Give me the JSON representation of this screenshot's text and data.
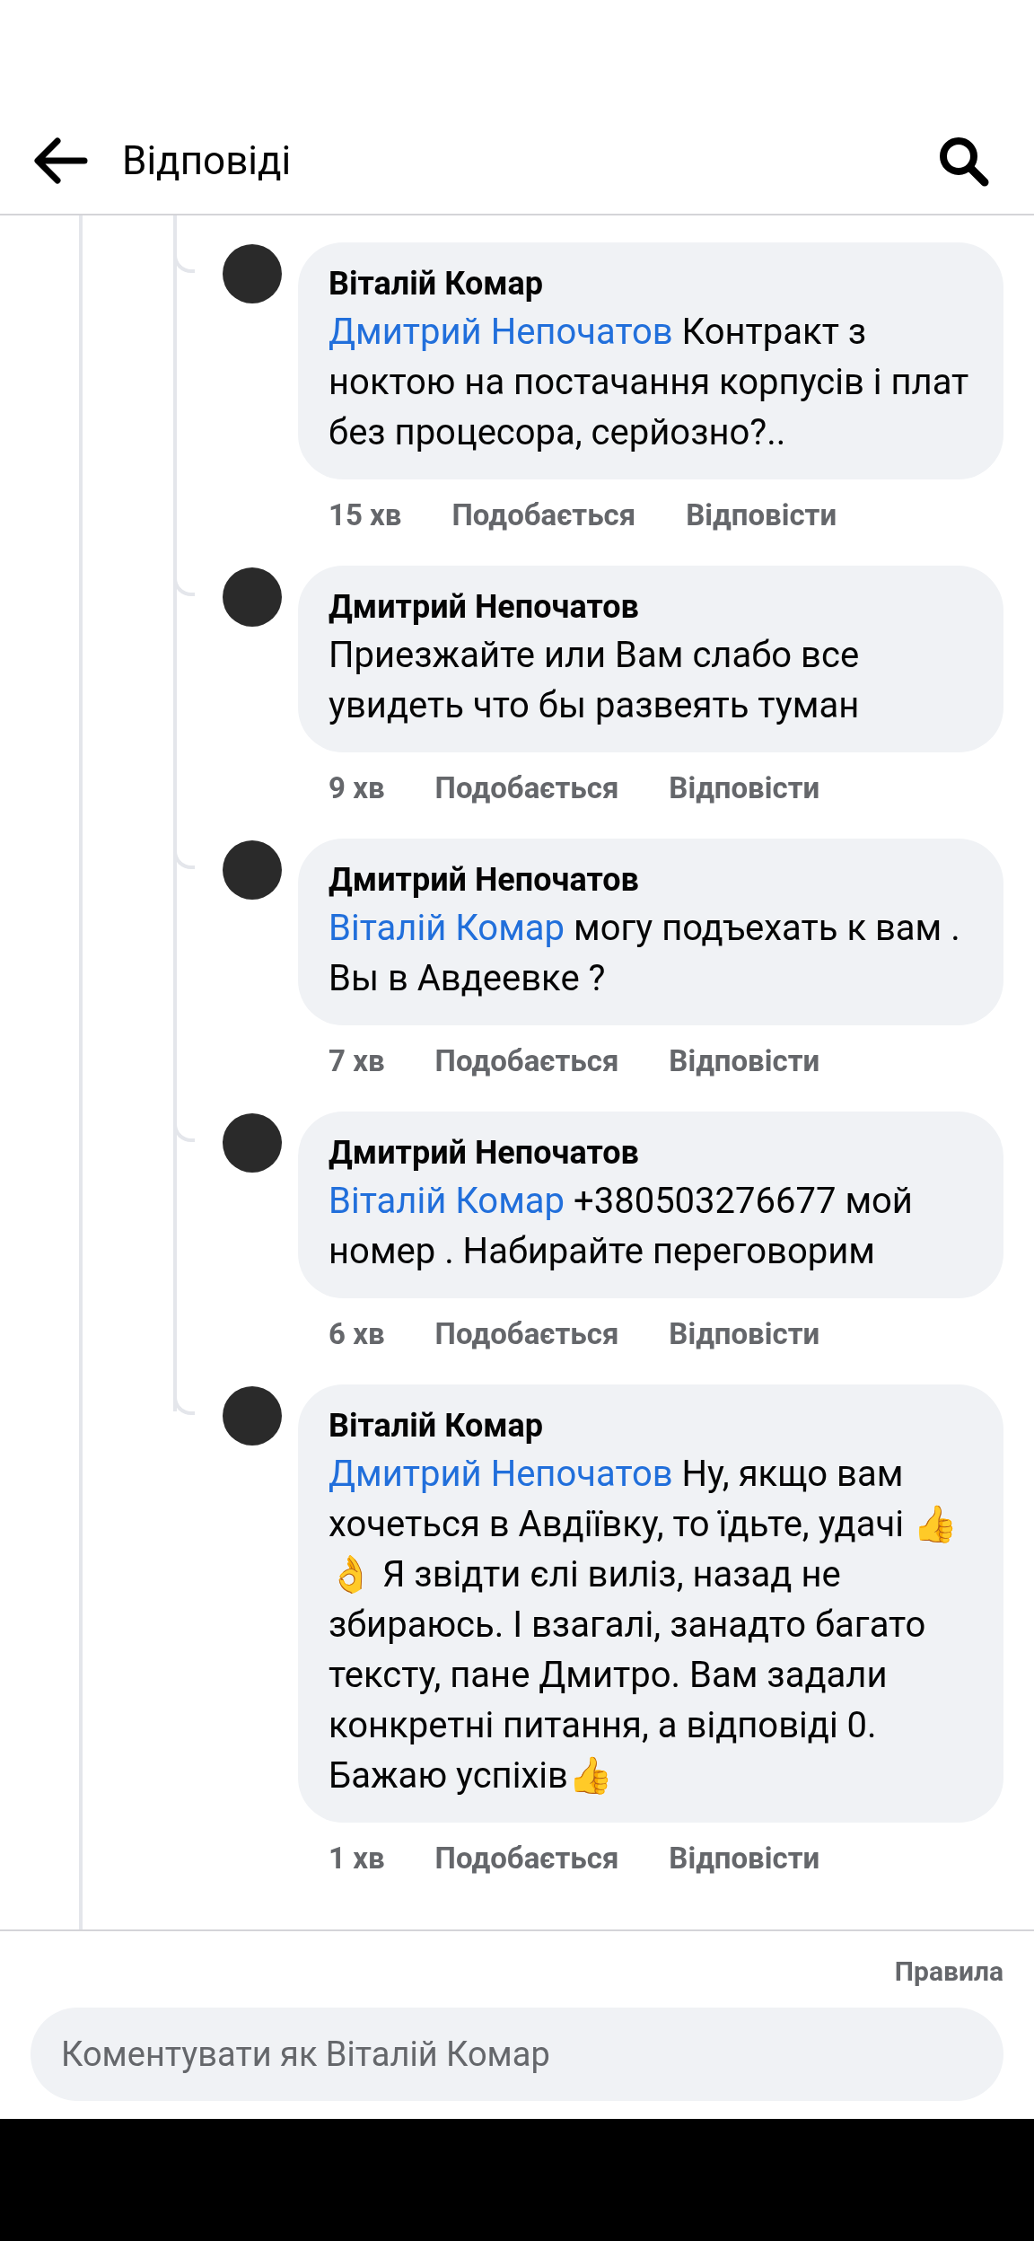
{
  "header": {
    "title": "Відповіді"
  },
  "comments": [
    {
      "author": "Віталій Комар",
      "mention": "Дмитрий Непочатов",
      "text": " Контракт з ноктою на постачання корпусів і плат без процесора, серйозно?..",
      "time": "15 хв",
      "like": "Подобається",
      "reply": "Відповісти"
    },
    {
      "author": "Дмитрий Непочатов",
      "text": "Приезжайте или Вам слабо все увидеть что бы развеять туман",
      "time": "9 хв",
      "like": "Подобається",
      "reply": "Відповісти"
    },
    {
      "author": "Дмитрий Непочатов",
      "mention": "Віталій Комар",
      "text": " могу подъехать к вам . Вы в Авдеевке ?",
      "time": "7 хв",
      "like": "Подобається",
      "reply": "Відповісти"
    },
    {
      "author": "Дмитрий Непочатов",
      "mention": "Віталій Комар",
      "text": " +380503276677 мой номер . Набирайте переговорим",
      "time": "6 хв",
      "like": "Подобається",
      "reply": "Відповісти"
    },
    {
      "author": "Віталій Комар",
      "mention": "Дмитрий Непочатов",
      "text": " Ну, якщо вам хочеться в Авдіївку, то їдьте, удачі 👍👌 Я звідти єлі виліз, назад не збираюсь. І взагалі, занадто багато тексту, пане Дмитро. Вам задали конкретні питання, а відповіді 0. Бажаю успіхів👍",
      "time": "1 хв",
      "like": "Подобається",
      "reply": "Відповісти"
    }
  ],
  "footer": {
    "rules": "Правила",
    "placeholder": "Коментувати як Віталій Комар"
  }
}
